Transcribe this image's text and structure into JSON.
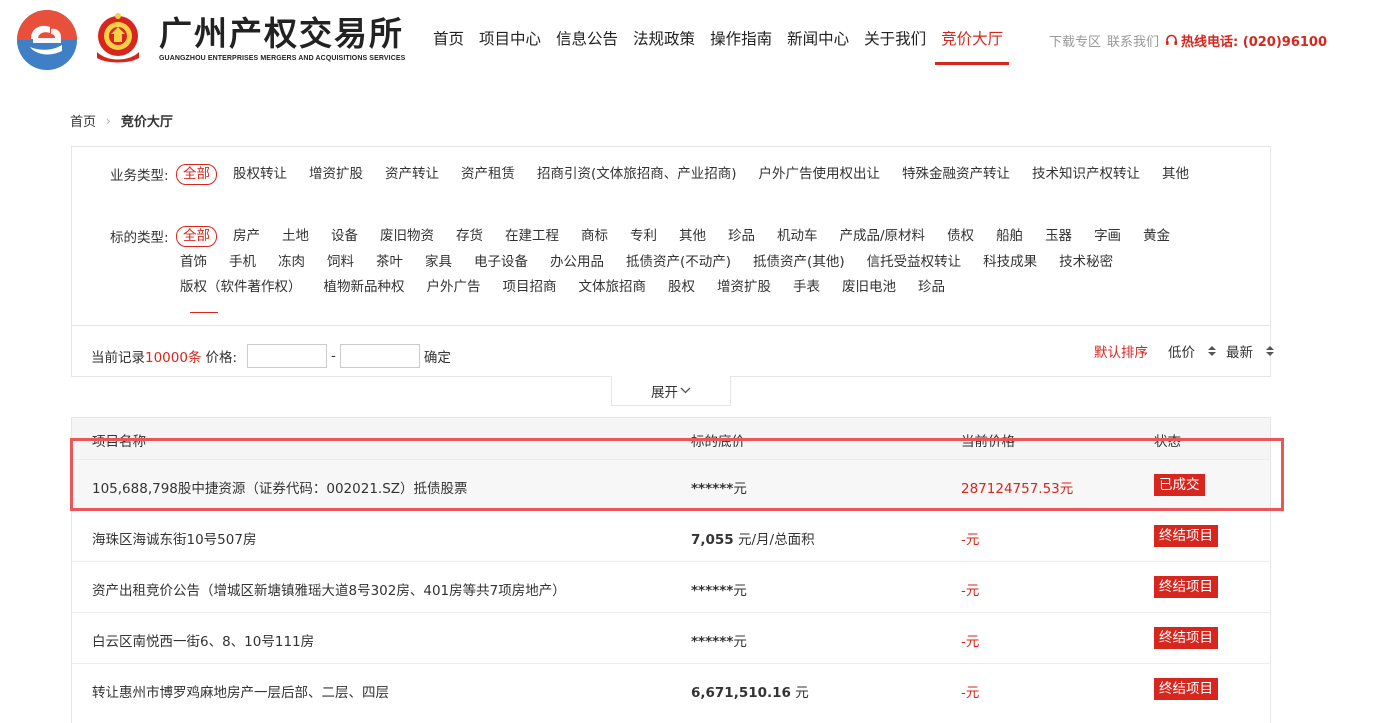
{
  "brand": {
    "name_cn": "广州产权交易所",
    "name_en": "GUANGZHOU ENTERPRISES MERGERS AND ACQUISITIONS SERVICES"
  },
  "nav": {
    "items": [
      "首页",
      "项目中心",
      "信息公告",
      "法规政策",
      "操作指南",
      "新闻中心",
      "关于我们",
      "竞价大厅"
    ],
    "active": "竞价大厅"
  },
  "top_links": {
    "download": "下载专区",
    "contact": "联系我们",
    "hotline": "热线电话: (020)96100"
  },
  "breadcrumb": [
    "首页",
    "竞价大厅"
  ],
  "filters": {
    "business_label": "业务类型:",
    "business_options": [
      "全部",
      "股权转让",
      "增资扩股",
      "资产转让",
      "资产租赁",
      "招商引资(文体旅招商、产业招商)",
      "户外广告使用权出让",
      "特殊金融资产转让",
      "技术知识产权转让",
      "其他"
    ],
    "target_label": "标的类型:",
    "target_options": [
      "全部",
      "房产",
      "土地",
      "设备",
      "废旧物资",
      "存货",
      "在建工程",
      "商标",
      "专利",
      "其他",
      "珍品",
      "机动车",
      "产成品/原材料",
      "债权",
      "船舶",
      "玉器",
      "字画",
      "黄金",
      "首饰",
      "手机",
      "冻肉",
      "饲料",
      "茶叶",
      "家具",
      "电子设备",
      "办公用品",
      "抵债资产(不动产)",
      "抵债资产(其他)",
      "信托受益权转让",
      "科技成果",
      "技术秘密",
      "版权（软件著作权）",
      "植物新品种权",
      "户外广告",
      "项目招商",
      "文体旅招商",
      "股权",
      "增资扩股",
      "手表",
      "废旧电池",
      "珍品"
    ]
  },
  "records": {
    "prefix": "当前记录",
    "count": "10000条",
    "price_label": "价格:",
    "dash": "-",
    "confirm": "确定"
  },
  "sort": {
    "default": "默认排序",
    "price": "低价",
    "latest": "最新"
  },
  "expand_label": "展开",
  "table": {
    "headers": [
      "项目名称",
      "标的底价",
      "当前价格",
      "状态"
    ],
    "rows": [
      {
        "name": "105,688,798股中捷资源（证券代码：002021.SZ）抵债股票",
        "base_bold": "******",
        "base_unit": "元",
        "current": "287124757.53元",
        "status": "已成交"
      },
      {
        "name": "海珠区海诚东街10号507房",
        "base_bold": "7,055",
        "base_unit": " 元/月/总面积",
        "current": "-元",
        "status": "终结项目"
      },
      {
        "name": "资产出租竞价公告（增城区新塘镇雅瑶大道8号302房、401房等共7项房地产）",
        "base_bold": "******",
        "base_unit": "元",
        "current": "-元",
        "status": "终结项目"
      },
      {
        "name": "白云区南悦西一街6、8、10号111房",
        "base_bold": "******",
        "base_unit": "元",
        "current": "-元",
        "status": "终结项目"
      },
      {
        "name": "转让惠州市博罗鸡麻地房产一层后部、二层、四层",
        "base_bold": "6,671,510.16",
        "base_unit": " 元",
        "current": "-元",
        "status": "终结项目"
      }
    ]
  },
  "colors": {
    "accent": "#d7261d",
    "highlight_box": "#e8575a"
  }
}
